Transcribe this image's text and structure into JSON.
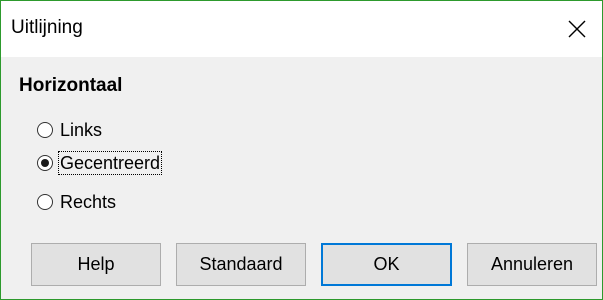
{
  "window": {
    "title": "Uitlijning",
    "close_icon": "close-icon"
  },
  "section": {
    "heading": "Horizontaal"
  },
  "options": [
    {
      "label": "Links",
      "checked": false
    },
    {
      "label": "Gecentreerd",
      "checked": true
    },
    {
      "label": "Rechts",
      "checked": false
    }
  ],
  "buttons": {
    "help": "Help",
    "default": "Standaard",
    "ok": "OK",
    "cancel": "Annuleren"
  },
  "colors": {
    "window_border": "#2d9a2d",
    "dialog_background": "#f0f0f0",
    "default_button_border": "#0078d7"
  }
}
